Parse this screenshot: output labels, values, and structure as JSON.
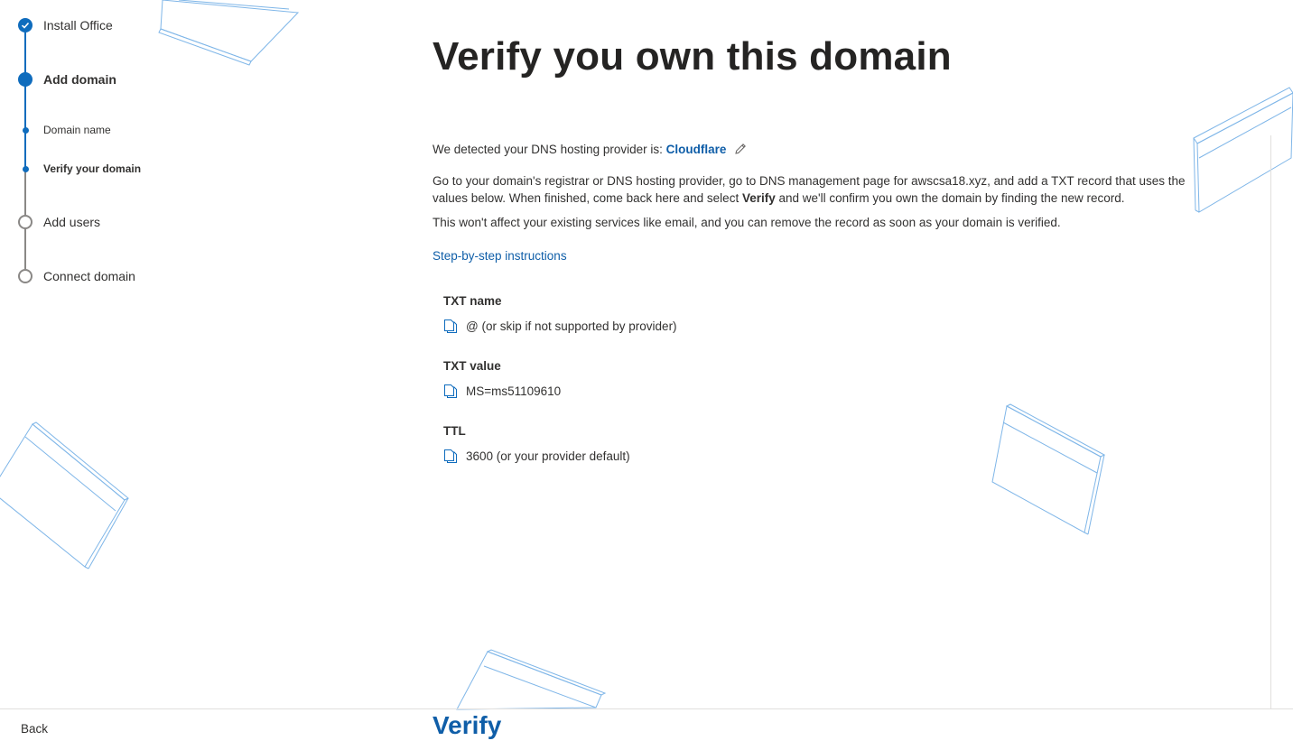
{
  "stepper": {
    "steps": [
      {
        "label": "Install Office",
        "state": "done"
      },
      {
        "label": "Add domain",
        "state": "current"
      },
      {
        "label": "Domain name",
        "state": "sub-done"
      },
      {
        "label": "Verify your domain",
        "state": "sub-current"
      },
      {
        "label": "Add users",
        "state": "pending"
      },
      {
        "label": "Connect domain",
        "state": "pending"
      }
    ]
  },
  "main": {
    "title": "Verify you own this domain",
    "detected_prefix": "We detected your DNS hosting provider is: ",
    "provider": "Cloudflare",
    "instructions_part1": "Go to your domain's registrar or DNS hosting provider, go to DNS management page for awscsa18.xyz, and add a TXT record that uses the values below. When finished, come back here and select ",
    "instructions_bold": "Verify",
    "instructions_part2": " and we'll confirm you own the domain by finding the new record.",
    "note": "This won't affect your existing services like email, and you can remove the record as soon as your domain is verified.",
    "step_link": "Step-by-step instructions",
    "records": [
      {
        "label": "TXT name",
        "value": "@ (or skip if not supported by provider)"
      },
      {
        "label": "TXT value",
        "value": "MS=ms51109610"
      },
      {
        "label": "TTL",
        "value": "3600 (or your provider default)"
      }
    ]
  },
  "footer": {
    "back_label": "Back",
    "verify_label": "Verify"
  },
  "icons": {
    "check": "check-icon",
    "copy": "copy-icon",
    "edit": "pencil-icon"
  },
  "colors": {
    "accent": "#0f6cbd",
    "link": "#0f5ea8",
    "text": "#323130"
  }
}
